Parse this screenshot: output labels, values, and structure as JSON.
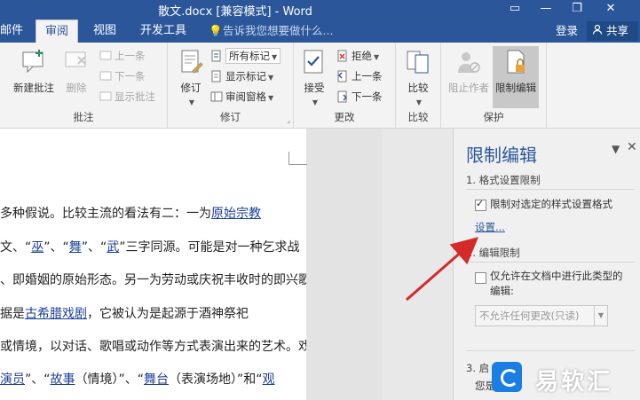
{
  "titlebar": {
    "title": "散文.docx [兼容模式] - Word",
    "restore_icon": "restore-icon",
    "close_icon": "close-icon"
  },
  "tabs": [
    {
      "label": "邮件"
    },
    {
      "label": "审阅",
      "active": true
    },
    {
      "label": "视图"
    },
    {
      "label": "开发工具"
    }
  ],
  "tellme": {
    "text": "告诉我您想要做什么..."
  },
  "account": {
    "login": "登录",
    "share": "共享"
  },
  "ribbon": {
    "comments": {
      "group_label": "批注",
      "new": "新建批注",
      "delete": "删除",
      "prev": "上一条",
      "next": "下一条",
      "show": "显示批注"
    },
    "tracking": {
      "group_label": "修订",
      "track": "修订",
      "markup_select": "所有标记",
      "show_markup": "显示标记",
      "review_pane": "审阅窗格"
    },
    "changes": {
      "group_label": "更改",
      "accept": "接受",
      "reject": "拒绝",
      "prev": "上一条",
      "next": "下一条"
    },
    "compare": {
      "group_label": "比较",
      "compare": "比较"
    },
    "protect": {
      "group_label": "保护",
      "block_authors": "阻止作者",
      "restrict": "限制编辑"
    }
  },
  "document": {
    "lines": [
      [
        {
          "t": "多种假说。比较主流的看法有二：一为"
        },
        {
          "t": "原始宗教",
          "link": true
        }
      ],
      [
        {
          "t": "文、“"
        },
        {
          "t": "巫",
          "link": true
        },
        {
          "t": "”、“"
        },
        {
          "t": "舞",
          "link": true
        },
        {
          "t": "”、“"
        },
        {
          "t": "武",
          "link": true
        },
        {
          "t": "”三字同源。可能是对一种乞求战"
        }
      ],
      [
        {
          "t": "、即婚姻的原始形态。另一为劳动或庆祝丰收时的即兴歌"
        }
      ],
      [
        {
          "t": "据是"
        },
        {
          "t": "古希腊戏剧",
          "link": true
        },
        {
          "t": "，它被认为是起源于酒神祭祀"
        }
      ],
      [
        {
          "t": "或情境，以对话、歌唱或动作等方式表演出来的艺术。戏"
        }
      ],
      [
        {
          "t": "演员",
          "link": true
        },
        {
          "t": "”、“"
        },
        {
          "t": "故事",
          "link": true
        },
        {
          "t": "（情境）”、“"
        },
        {
          "t": "舞台",
          "link": true
        },
        {
          "t": "（表演场地）”和“"
        },
        {
          "t": "观",
          "link": true
        }
      ]
    ]
  },
  "pane": {
    "title": "限制编辑",
    "section1": "1. 格式设置限制",
    "format_check_label": "限制对选定的样式设置格式",
    "format_checked": true,
    "settings_link": "设置...",
    "section2": "2. 编辑限制",
    "edit_check_label_1": "仅允许在文档中进行此类型的",
    "edit_check_label_2": "编辑:",
    "edit_checked": false,
    "edit_select": "不允许任何更改(只读)",
    "section3": "3. 启",
    "section3_text": "您是"
  },
  "watermark": {
    "text": "易软汇"
  },
  "colors": {
    "accent": "#2b579a",
    "link": "#1b3f97",
    "arrow": "#d42a2a"
  }
}
